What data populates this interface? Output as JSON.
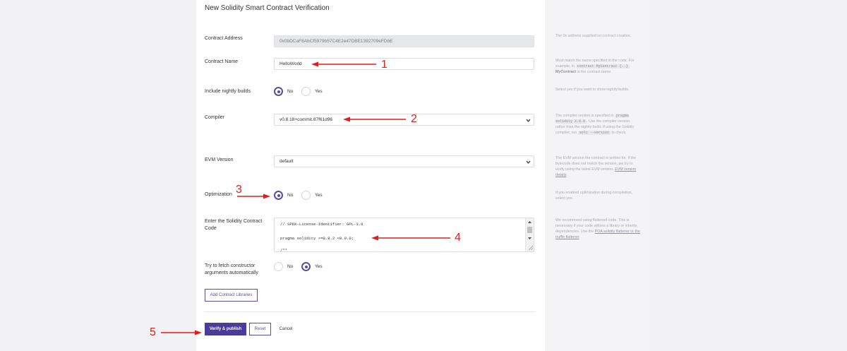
{
  "page": {
    "title": "New Solidity Smart Contract Verification"
  },
  "form": {
    "contract_address": {
      "label": "Contract Address",
      "value": "0x0bDCaF6AbCf5979b57C4E2e47DBE1392709eFDbE"
    },
    "contract_name": {
      "label": "Contract Name",
      "value": "HelloWorld"
    },
    "nightly": {
      "label": "Include nightly builds",
      "no": "No",
      "yes": "Yes",
      "selected": "No"
    },
    "compiler": {
      "label": "Compiler",
      "value": "v0.8.18+commit.87f61d96"
    },
    "evm": {
      "label": "EVM Version",
      "value": "default"
    },
    "optimization": {
      "label": "Optimization",
      "no": "No",
      "yes": "Yes",
      "selected": "No"
    },
    "code": {
      "label": "Enter the Solidity Contract Code",
      "line1": "// SPDX-License-Identifier: GPL-3.0",
      "line2": "pragma solidity >=0.8.2 <0.9.0;",
      "line3": "/**"
    },
    "fetch_args": {
      "label": "Try to fetch constructor arguments automatically",
      "no": "No",
      "yes": "Yes",
      "selected": "Yes"
    },
    "add_libraries_label": "Add Contract Libraries",
    "verify_label": "Verify & publish",
    "reset_label": "Reset",
    "cancel_label": "Cancel"
  },
  "help": {
    "address": "The 0x address supplied on contract creation.",
    "name_a": "Must match the name specified in the code. For example, in",
    "name_chip": "contract MyContract {..}",
    "name_b": ". ",
    "name_bold": "MyContract",
    "name_c": " is the contract name.",
    "nightly": "Select yes if you want to show nightly builds.",
    "compiler_a": "The compiler version is specified in",
    "compiler_chip1": "pragma solidity X.X.X",
    "compiler_b": ". Use the compiler version rather than the nightly build. If using the Solidity compiler, run",
    "compiler_chip2": "solc --version",
    "compiler_c": "to check.",
    "evm_a": "The EVM version the contract is written for. If the bytecode does not match the version, we try to verify using the latest EVM version.",
    "evm_link": "EVM version details",
    "evm_b": ".",
    "optimization": "If you enabled optimization during compilation, select yes.",
    "code_a": "We recommend using flattened code. This is necessary if your code utilizes a library or inherits dependencies. Use the",
    "code_link": "POA solidity flattener or the truffle flattener",
    "code_b": "."
  },
  "annotations": {
    "n1": "1",
    "n2": "2",
    "n3": "3",
    "n4": "4",
    "n5": "5",
    "color": "#e11d1d"
  },
  "colors": {
    "accent": "#4b3b9a",
    "background": "#f2f2f4",
    "sidebar": "#f4f4f6"
  }
}
